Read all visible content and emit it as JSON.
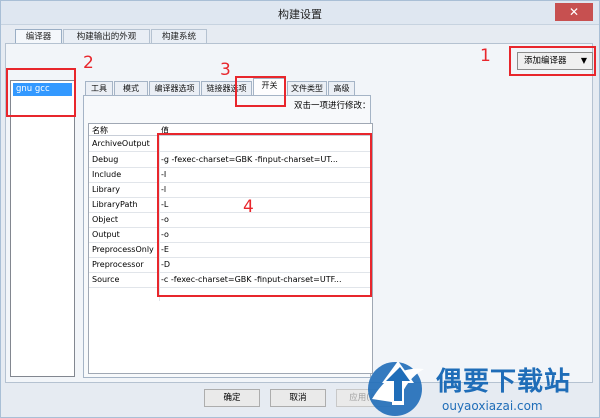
{
  "window": {
    "title": "构建设置",
    "close_glyph": "✕"
  },
  "top_tabs": [
    {
      "label": "编译器",
      "active": true
    },
    {
      "label": "构建输出的外观",
      "active": false
    },
    {
      "label": "构建系统",
      "active": false
    }
  ],
  "add_compiler": {
    "label": "添加编译器",
    "arrow": "▼"
  },
  "compiler_list": {
    "items": [
      "gnu gcc"
    ],
    "selected": "gnu gcc"
  },
  "inner_tabs": [
    {
      "label": "工具",
      "active": false
    },
    {
      "label": "模式",
      "active": false
    },
    {
      "label": "编译器选项",
      "active": false
    },
    {
      "label": "链接器选项",
      "active": false
    },
    {
      "label": "开关",
      "active": true
    },
    {
      "label": "文件类型",
      "active": false
    },
    {
      "label": "高级",
      "active": false
    }
  ],
  "hint": "双击一项进行修改：",
  "table": {
    "columns": [
      "名称",
      "值"
    ],
    "rows": [
      {
        "name": "ArchiveOutput",
        "value": ""
      },
      {
        "name": "Debug",
        "value": "-g -fexec-charset=GBK -finput-charset=UT..."
      },
      {
        "name": "Include",
        "value": "-I"
      },
      {
        "name": "Library",
        "value": "-l"
      },
      {
        "name": "LibraryPath",
        "value": "-L"
      },
      {
        "name": "Object",
        "value": "-o"
      },
      {
        "name": "Output",
        "value": "-o"
      },
      {
        "name": "PreprocessOnly",
        "value": "-E"
      },
      {
        "name": "Preprocessor",
        "value": "-D"
      },
      {
        "name": "Source",
        "value": "-c -fexec-charset=GBK -finput-charset=UTF..."
      }
    ]
  },
  "buttons": {
    "ok": "确定",
    "cancel": "取消",
    "apply": "应用(A)"
  },
  "annotations": [
    "1",
    "2",
    "3",
    "4"
  ],
  "watermark": {
    "name": "偶要下载站",
    "url": "ouyaoxiazai.com"
  },
  "colors": {
    "selection": "#3399ff",
    "annotation": "#e8262c",
    "watermark": "#1f6db8"
  }
}
